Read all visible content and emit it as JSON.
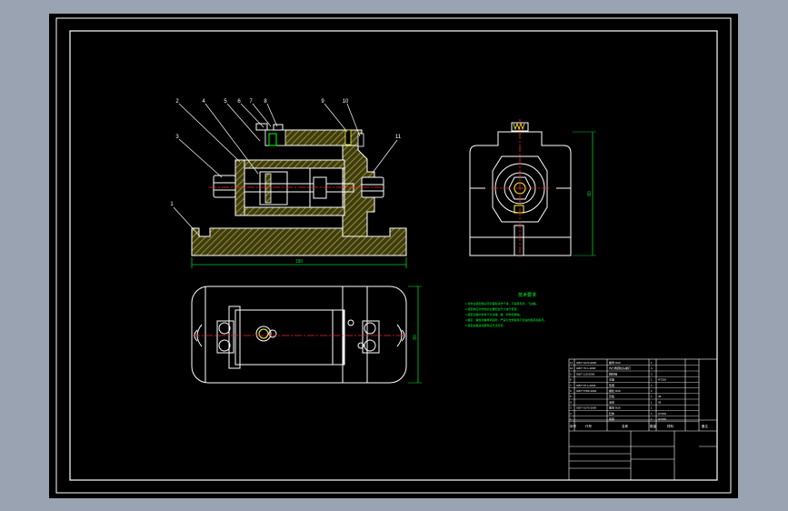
{
  "theme": {
    "background": "#000000",
    "outline": "#ffffff",
    "hatch": "#8a8a2a",
    "dimension": "#00cc33",
    "centerline": "#ff2020",
    "notes": "#00ff33",
    "highlight": "#ffd400"
  },
  "balloons": [
    "2",
    "4",
    "5",
    "6",
    "7",
    "8",
    "9",
    "10",
    "11",
    "3",
    "1"
  ],
  "dimensions": {
    "front_length": "180",
    "side_height": "80",
    "top_height": "80"
  },
  "notes": {
    "title": "技术要求",
    "lines": [
      "1.零件在装配前必须清理和清洗干净，不得有毛刺、飞边等。",
      "2.装配前应对零件的主要配合尺寸进行复查。",
      "3.装配过程中零件不允许磕、碰、划伤和锈蚀。",
      "4.螺钉、螺栓和螺母紧固时，严禁打击或使用不合适的旋具和扳手。",
      "5.装配后各运动部件应灵活可靠。"
    ]
  },
  "title_block": {
    "rows": [
      [
        "11",
        "GB/T 6170-2000",
        "螺母 M16",
        "1",
        "",
        ""
      ],
      [
        "10",
        "GB/T 70.1-2000",
        "内六角圆柱头螺钉",
        "4",
        "",
        ""
      ],
      [
        "9",
        "GB/T 119-2000",
        "圆柱销",
        "2",
        "",
        ""
      ],
      [
        "8",
        "",
        "支座",
        "1",
        "HT200",
        ""
      ],
      [
        "7",
        "GB/T 97.1-2002",
        "垫圈",
        "1",
        "",
        ""
      ],
      [
        "6",
        "GB/T 5783-2000",
        "螺栓 M10",
        "1",
        "",
        ""
      ],
      [
        "5",
        "",
        "压板",
        "1",
        "45",
        ""
      ],
      [
        "4",
        "",
        "活塞",
        "1",
        "45",
        ""
      ],
      [
        "3",
        "GB/T 6170-2000",
        "螺母 M16",
        "1",
        "",
        ""
      ],
      [
        "2",
        "",
        "缸体",
        "1",
        "HT200",
        ""
      ],
      [
        "1",
        "",
        "底座",
        "1",
        "HT200",
        ""
      ]
    ],
    "header": [
      "序号",
      "代号",
      "名称",
      "数量",
      "材料",
      "备注"
    ],
    "company": "",
    "drawing_name": ""
  }
}
